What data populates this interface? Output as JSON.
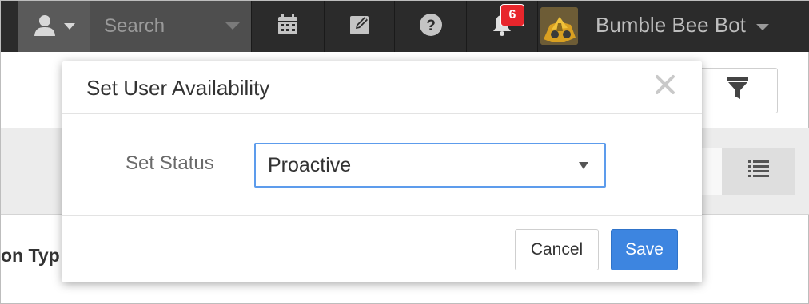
{
  "topbar": {
    "search": {
      "placeholder": "Search"
    },
    "notifications": {
      "count": "6"
    },
    "user": {
      "name": "Bumble Bee Bot"
    },
    "colors": {
      "bar": "#2b2b2b",
      "badge": "#e8262c"
    }
  },
  "page": {
    "column_header": "on Typ"
  },
  "modal": {
    "title": "Set User Availability",
    "status_label": "Set Status",
    "status_value": "Proactive",
    "cancel_label": "Cancel",
    "save_label": "Save",
    "colors": {
      "save": "#3d85e0",
      "select_border": "#5d9cec"
    }
  },
  "icons": [
    "user-icon",
    "calendar-icon",
    "edit-icon",
    "help-icon",
    "bell-icon",
    "filter-icon",
    "list-icon",
    "close-icon"
  ]
}
